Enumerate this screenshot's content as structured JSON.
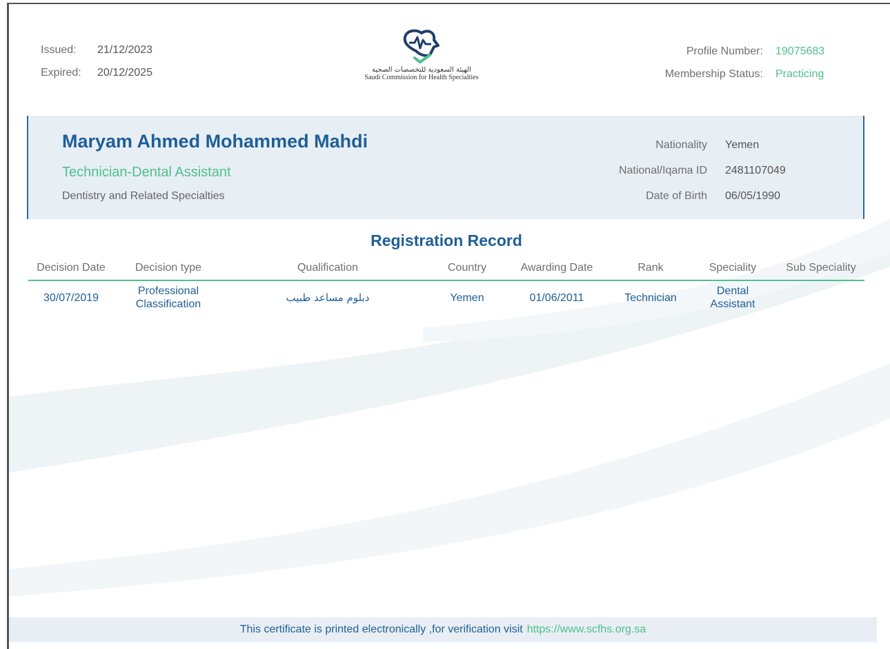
{
  "header": {
    "issued_label": "Issued:",
    "issued_value": "21/12/2023",
    "expired_label": "Expired:",
    "expired_value": "20/12/2025",
    "profile_number_label": "Profile Number:",
    "profile_number_value": "19075683",
    "membership_status_label": "Membership Status:",
    "membership_status_value": "Practicing",
    "logo_ar": "الهيئة السعودية للتخصصات الصحية",
    "logo_en": "Saudi Commission for Health Specialties"
  },
  "profile": {
    "name": "Maryam Ahmed Mohammed Mahdi",
    "title": "Technician-Dental Assistant",
    "specialty": "Dentistry and Related Specialties",
    "fields": [
      {
        "label": "Nationality",
        "value": "Yemen"
      },
      {
        "label": "National/Iqama ID",
        "value": "2481107049"
      },
      {
        "label": "Date of Birth",
        "value": "06/05/1990"
      }
    ]
  },
  "registration": {
    "title": "Registration Record",
    "columns": [
      "Decision Date",
      "Decision type",
      "Qualification",
      "Country",
      "Awarding Date",
      "Rank",
      "Speciality",
      "Sub Speciality"
    ],
    "rows": [
      [
        "30/07/2019",
        "Professional Classification",
        "دبلوم مساعد طبيب",
        "Yemen",
        "01/06/2011",
        "Technician",
        "Dental Assistant",
        ""
      ]
    ]
  },
  "footer": {
    "text": "This certificate is printed electronically ,for verification visit",
    "link": "https://www.scfhs.org.sa"
  },
  "colors": {
    "primary_blue": "#1f5f97",
    "accent_green": "#4fc08d",
    "panel_bg": "#e7eef4"
  }
}
